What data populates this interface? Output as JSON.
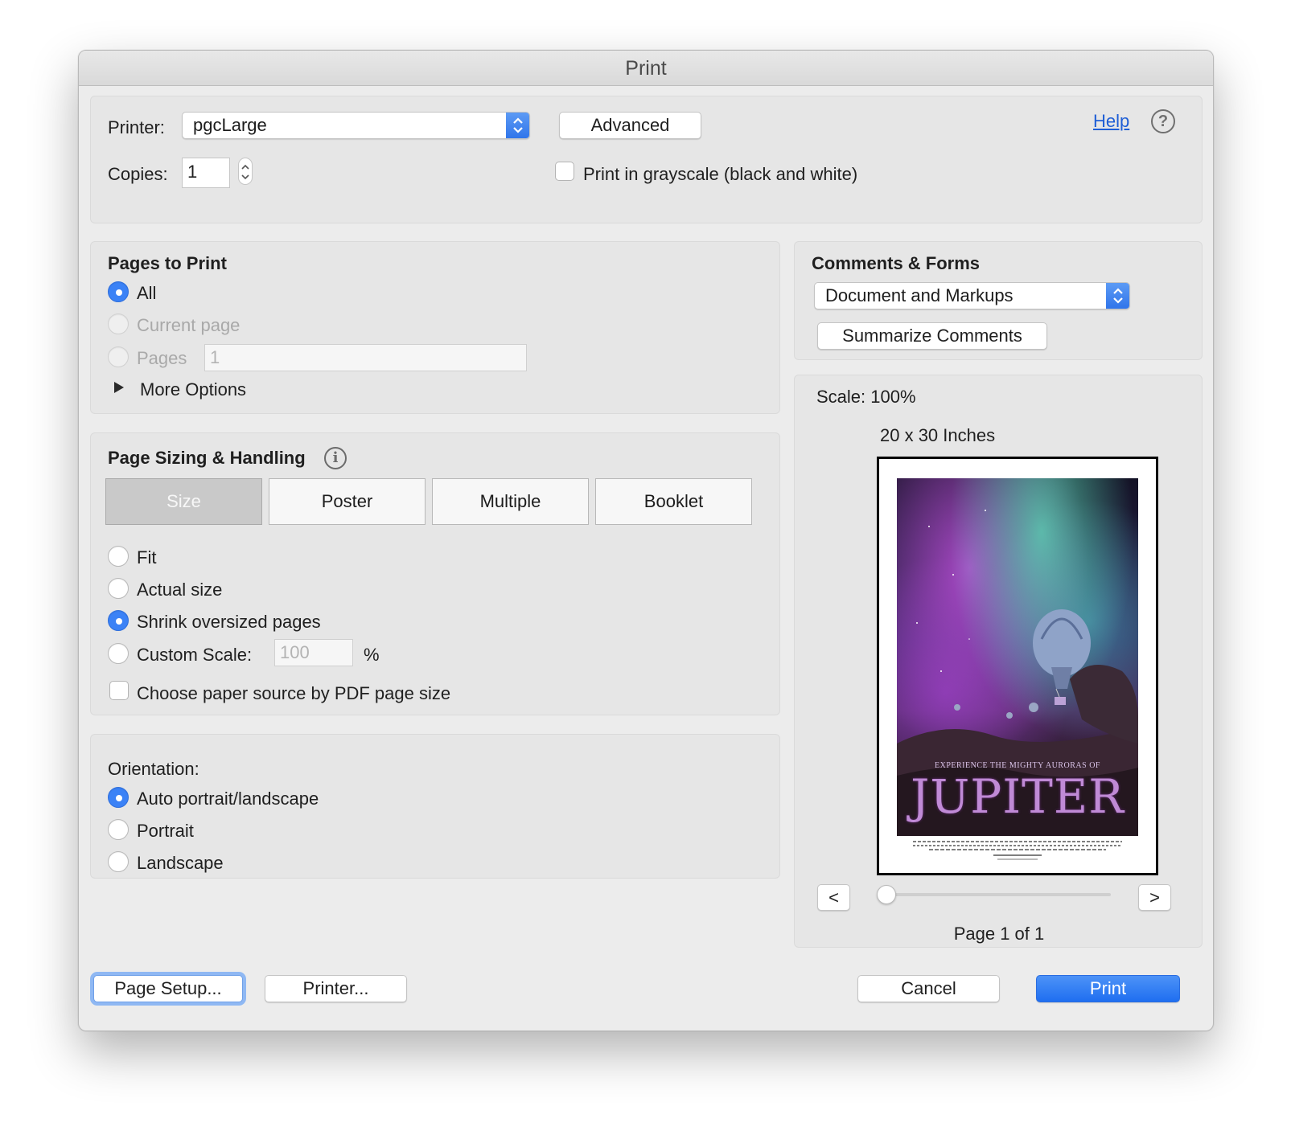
{
  "window": {
    "title": "Print"
  },
  "top": {
    "printer_label": "Printer:",
    "printer_value": "pgcLarge",
    "advanced_label": "Advanced",
    "help_label": "Help",
    "help_icon": "question-circle-icon",
    "copies_label": "Copies:",
    "copies_value": "1",
    "grayscale_label": "Print in grayscale (black and white)",
    "grayscale_checked": false
  },
  "pages_to_print": {
    "title": "Pages to Print",
    "options": [
      {
        "label": "All",
        "selected": true,
        "enabled": true
      },
      {
        "label": "Current page",
        "selected": false,
        "enabled": false
      },
      {
        "label": "Pages",
        "selected": false,
        "enabled": false
      }
    ],
    "pages_value": "1",
    "more_options_label": "More Options"
  },
  "sizing": {
    "title": "Page Sizing & Handling",
    "info_icon": "info-circle-icon",
    "tabs": [
      "Size",
      "Poster",
      "Multiple",
      "Booklet"
    ],
    "active_tab": "Size",
    "options": [
      {
        "label": "Fit",
        "selected": false
      },
      {
        "label": "Actual size",
        "selected": false
      },
      {
        "label": "Shrink oversized pages",
        "selected": true
      },
      {
        "label": "Custom Scale:",
        "selected": false
      }
    ],
    "custom_scale_value": "100",
    "custom_scale_unit": "%",
    "paper_source_label": "Choose paper source by PDF page size",
    "paper_source_checked": false
  },
  "orientation": {
    "title": "Orientation:",
    "options": [
      {
        "label": "Auto portrait/landscape",
        "selected": true
      },
      {
        "label": "Portrait",
        "selected": false
      },
      {
        "label": "Landscape",
        "selected": false
      }
    ]
  },
  "comments": {
    "title": "Comments & Forms",
    "value": "Document and Markups",
    "summarize_label": "Summarize Comments"
  },
  "preview": {
    "scale_label": "Scale: 100%",
    "size_label": "20 x 30 Inches",
    "poster_tagline": "EXPERIENCE THE MIGHTY AURORAS OF",
    "poster_title": "JUPITER",
    "prev_label": "<",
    "next_label": ">",
    "page_fraction": 0.0,
    "page_label": "Page 1 of 1"
  },
  "footer": {
    "page_setup_label": "Page Setup...",
    "printer_label": "Printer...",
    "cancel_label": "Cancel",
    "print_label": "Print"
  },
  "colors": {
    "accent": "#3b82f6",
    "primary_button": "#1f6ef0",
    "link": "#1e5ed6"
  }
}
